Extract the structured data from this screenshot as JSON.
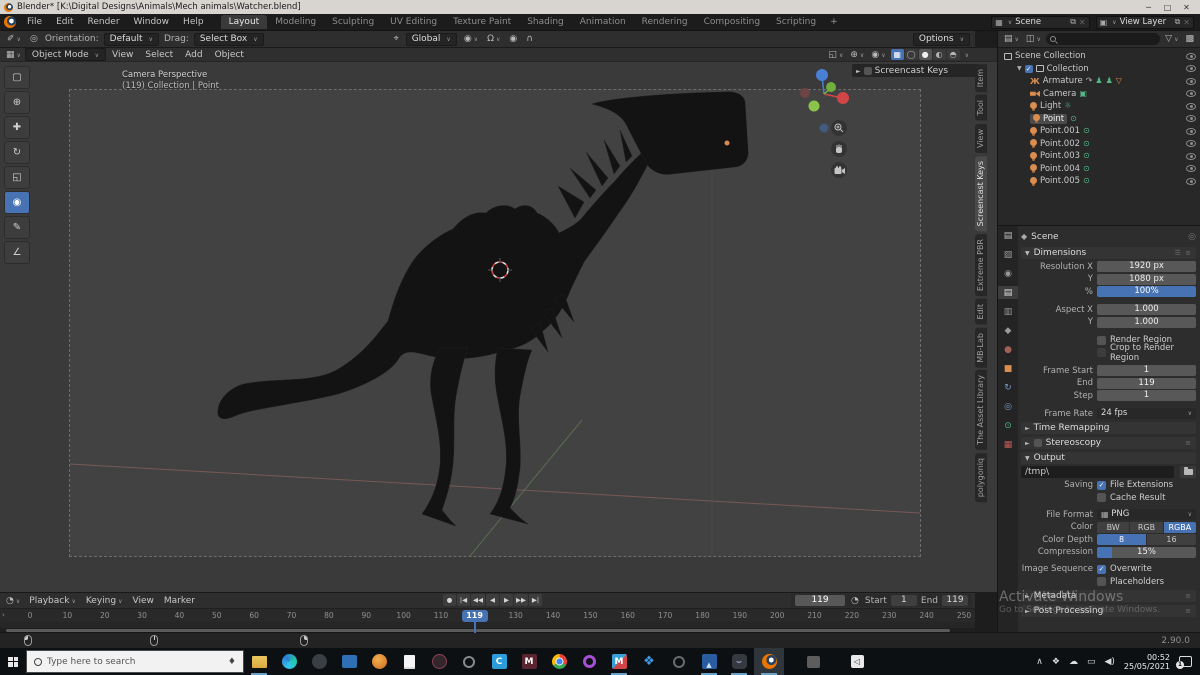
{
  "window": {
    "title": "Blender* [K:\\Digital Designs\\Animals\\Mech animals\\Watcher.blend]",
    "controls": [
      "─",
      "□",
      "✕"
    ],
    "version": "2.90.0"
  },
  "topbar": {
    "menus": [
      "File",
      "Edit",
      "Render",
      "Window",
      "Help"
    ],
    "workspaces": [
      "Layout",
      "Modeling",
      "Sculpting",
      "UV Editing",
      "Texture Paint",
      "Shading",
      "Animation",
      "Rendering",
      "Compositing",
      "Scripting"
    ],
    "active_workspace": "Layout",
    "new_workspace": "+",
    "scene": "Scene",
    "view_layer": "View Layer"
  },
  "tool_settings": {
    "orientation_label": "Orientation:",
    "orientation_value": "Default",
    "drag_label": "Drag:",
    "drag_value": "Select Box",
    "transform_orientation": "Global",
    "options_label": "Options"
  },
  "viewport": {
    "header_menus": [
      "Object Mode",
      "View",
      "Select",
      "Add",
      "Object"
    ],
    "overlay_line1": "Camera Perspective",
    "overlay_line2": "(119) Collection | Point",
    "screencast_title": "Screencast Keys",
    "sidebar_tabs": [
      "Item",
      "Tool",
      "View",
      "Screencast Keys",
      "Extreme PBR",
      "Edit",
      "MB-Lab",
      "The Asset Library",
      "polygoniq"
    ],
    "active_sidebar_tab": "Screencast Keys",
    "tools": [
      {
        "name": "select-box-tool",
        "glyph": "▢"
      },
      {
        "name": "cursor-tool",
        "glyph": "⊕"
      },
      {
        "name": "move-tool",
        "glyph": "✚"
      },
      {
        "name": "rotate-tool",
        "glyph": "↻"
      },
      {
        "name": "scale-tool",
        "glyph": "◱"
      },
      {
        "name": "transform-tool",
        "glyph": "◉"
      },
      {
        "name": "annotate-tool",
        "glyph": "✎"
      },
      {
        "name": "measure-tool",
        "glyph": "∠"
      }
    ],
    "active_tool": "transform-tool",
    "shading_modes": [
      {
        "name": "toggle-xray",
        "glyph": "▦",
        "state": "xray"
      },
      {
        "name": "wireframe-shading",
        "glyph": "◯",
        "state": ""
      },
      {
        "name": "solid-shading",
        "glyph": "●",
        "state": "on"
      },
      {
        "name": "material-shading",
        "glyph": "◐",
        "state": ""
      },
      {
        "name": "rendered-shading",
        "glyph": "◓",
        "state": ""
      }
    ]
  },
  "outliner": {
    "rows": [
      {
        "label": "Scene Collection",
        "level": 0,
        "icon": "box",
        "disclosure": false,
        "checkbox": false,
        "selected": false,
        "badges": []
      },
      {
        "label": "Collection",
        "level": 1,
        "icon": "box",
        "disclosure": true,
        "checkbox": true,
        "selected": false,
        "badges": []
      },
      {
        "label": "Armature",
        "level": 2,
        "icon": "armature",
        "disclosure": false,
        "checkbox": false,
        "selected": false,
        "badges": [
          "pose",
          "figure",
          "figure",
          "triangle"
        ]
      },
      {
        "label": "Camera",
        "level": 2,
        "icon": "camera",
        "disclosure": false,
        "checkbox": false,
        "selected": false,
        "badges": [
          "camera-data"
        ]
      },
      {
        "label": "Light",
        "level": 2,
        "icon": "bulb",
        "disclosure": false,
        "checkbox": false,
        "selected": false,
        "badges": [
          "sun-data"
        ]
      },
      {
        "label": "Point",
        "level": 2,
        "icon": "bulb",
        "disclosure": false,
        "checkbox": false,
        "selected": true,
        "badges": [
          "light-data"
        ]
      },
      {
        "label": "Point.001",
        "level": 2,
        "icon": "bulb",
        "disclosure": false,
        "checkbox": false,
        "selected": false,
        "badges": [
          "light-data"
        ]
      },
      {
        "label": "Point.002",
        "level": 2,
        "icon": "bulb",
        "disclosure": false,
        "checkbox": false,
        "selected": false,
        "badges": [
          "light-data"
        ]
      },
      {
        "label": "Point.003",
        "level": 2,
        "icon": "bulb",
        "disclosure": false,
        "checkbox": false,
        "selected": false,
        "badges": [
          "light-data"
        ]
      },
      {
        "label": "Point.004",
        "level": 2,
        "icon": "bulb",
        "disclosure": false,
        "checkbox": false,
        "selected": false,
        "badges": [
          "light-data"
        ]
      },
      {
        "label": "Point.005",
        "level": 2,
        "icon": "bulb",
        "disclosure": false,
        "checkbox": false,
        "selected": false,
        "badges": [
          "light-data"
        ]
      }
    ]
  },
  "properties": {
    "breadcrumb": "Scene",
    "tabs": [
      {
        "name": "properties-editor-type",
        "glyph": "▤",
        "color": "#c0c0c0",
        "active": false
      },
      {
        "name": "properties-tab-tool",
        "glyph": "▨",
        "color": "#9a9a9a",
        "active": false
      },
      {
        "name": "properties-tab-render",
        "glyph": "◉",
        "color": "#9a9a9a",
        "active": false
      },
      {
        "name": "properties-tab-output",
        "glyph": "▤",
        "color": "#e0e0e0",
        "active": true
      },
      {
        "name": "properties-tab-view-layer",
        "glyph": "▥",
        "color": "#9a9a9a",
        "active": false
      },
      {
        "name": "properties-tab-scene",
        "glyph": "◆",
        "color": "#9a9a9a",
        "active": false
      },
      {
        "name": "properties-tab-world",
        "glyph": "●",
        "color": "#a06058",
        "active": false
      },
      {
        "name": "properties-tab-object",
        "glyph": "■",
        "color": "#d98d4e",
        "active": false
      },
      {
        "name": "properties-tab-physics",
        "glyph": "↻",
        "color": "#7a9cc9",
        "active": false
      },
      {
        "name": "properties-tab-constraints",
        "glyph": "◎",
        "color": "#7a9cc9",
        "active": false
      },
      {
        "name": "properties-tab-data",
        "glyph": "⊙",
        "color": "#55b685",
        "active": false
      },
      {
        "name": "properties-tab-texture",
        "glyph": "▦",
        "color": "#c25b5b",
        "active": false
      }
    ],
    "dimensions": {
      "title": "Dimensions",
      "resolution_x_label": "Resolution X",
      "resolution_x": "1920 px",
      "resolution_y_label": "Y",
      "resolution_y": "1080 px",
      "percent_label": "%",
      "percent": "100%",
      "aspect_x_label": "Aspect X",
      "aspect_x": "1.000",
      "aspect_y_label": "Y",
      "aspect_y": "1.000",
      "render_region_label": "Render Region",
      "crop_label": "Crop to Render Region",
      "frame_start_label": "Frame Start",
      "frame_start": "1",
      "end_label": "End",
      "end": "119",
      "step_label": "Step",
      "step": "1",
      "frame_rate_label": "Frame Rate",
      "frame_rate": "24 fps"
    },
    "sections": {
      "time_remapping": "Time Remapping",
      "stereoscopy": "Stereoscopy",
      "output": "Output",
      "metadata": "Metadata",
      "post_processing": "Post Processing"
    },
    "output": {
      "path": "/tmp\\",
      "saving_label": "Saving",
      "file_extensions_label": "File Extensions",
      "cache_result_label": "Cache Result",
      "file_format_label": "File Format",
      "file_format": "PNG",
      "color_label": "Color",
      "color_options": [
        "BW",
        "RGB",
        "RGBA"
      ],
      "color_active": "RGBA",
      "color_depth_label": "Color Depth",
      "depth_options": [
        "8",
        "16"
      ],
      "depth_active": "8",
      "compression_label": "Compression",
      "compression": "15%",
      "image_sequence_label": "Image Sequence",
      "overwrite_label": "Overwrite",
      "placeholders_label": "Placeholders"
    }
  },
  "timeline": {
    "menus": [
      "Playback",
      "Keying",
      "View",
      "Marker"
    ],
    "transport": [
      {
        "name": "record-button",
        "glyph": "●"
      },
      {
        "name": "jump-to-start-button",
        "glyph": "|◀"
      },
      {
        "name": "previous-keyframe-button",
        "glyph": "◀◀"
      },
      {
        "name": "play-reverse-button",
        "glyph": "◀"
      },
      {
        "name": "play-button",
        "glyph": "▶"
      },
      {
        "name": "next-keyframe-button",
        "glyph": "▶▶"
      },
      {
        "name": "jump-to-end-button",
        "glyph": "▶|"
      }
    ],
    "current_frame": "119",
    "start_label": "Start",
    "start": "1",
    "end_label": "End",
    "end": "119",
    "ruler": [
      0,
      10,
      20,
      30,
      40,
      50,
      60,
      70,
      80,
      90,
      100,
      110,
      130,
      140,
      150,
      160,
      170,
      180,
      190,
      200,
      210,
      220,
      230,
      240,
      250
    ],
    "playhead_frame": 119
  },
  "statusbar": {
    "version": "2.90.0"
  },
  "taskbar": {
    "search_placeholder": "Type here to search",
    "icons": [
      {
        "name": "file-explorer-icon",
        "cls": "tb-folder",
        "glyph": "",
        "running": true,
        "active": false
      },
      {
        "name": "edge-icon",
        "cls": "tb-edge",
        "glyph": "",
        "running": false,
        "active": false
      },
      {
        "name": "app-dark-icon",
        "cls": "tb-dark",
        "glyph": "",
        "running": false,
        "active": false
      },
      {
        "name": "app-blue-window-icon",
        "cls": "tb-bluewin",
        "glyph": "",
        "running": false,
        "active": false
      },
      {
        "name": "app-orange-icon",
        "cls": "tb-orange",
        "glyph": "",
        "running": false,
        "active": false
      },
      {
        "name": "notepad-icon",
        "cls": "tb-doc",
        "glyph": "",
        "running": false,
        "active": false
      },
      {
        "name": "app-dark-red-icon",
        "cls": "tb-darkred",
        "glyph": "",
        "running": false,
        "active": false
      },
      {
        "name": "app-grey-circle-icon",
        "cls": "tb-greycircle",
        "glyph": "",
        "running": false,
        "active": false
      },
      {
        "name": "app-blue-c-icon",
        "cls": "tb-bluec",
        "glyph": "C",
        "running": false,
        "active": false
      },
      {
        "name": "app-maroon-m-icon",
        "cls": "tb-maroonm",
        "glyph": "M",
        "running": false,
        "active": false
      },
      {
        "name": "chrome-icon",
        "cls": "tb-chrome",
        "glyph": "",
        "running": false,
        "active": false
      },
      {
        "name": "opera-icon",
        "cls": "tb-opera",
        "glyph": "",
        "running": false,
        "active": false
      },
      {
        "name": "app-m-color-icon",
        "cls": "tb-mcolor",
        "glyph": "M",
        "running": true,
        "active": false
      },
      {
        "name": "dropbox-icon",
        "cls": "tb-dropbox",
        "glyph": "❖",
        "running": false,
        "active": false
      },
      {
        "name": "app-ring-icon",
        "cls": "tb-ring",
        "glyph": "",
        "running": false,
        "active": false
      },
      {
        "name": "photos-icon",
        "cls": "tb-photos",
        "glyph": "▲",
        "running": true,
        "active": false
      },
      {
        "name": "discord-icon",
        "cls": "tb-discord",
        "glyph": "⌣",
        "running": true,
        "active": false
      },
      {
        "name": "blender-icon",
        "cls": "tb-blender",
        "glyph": "",
        "running": true,
        "active": true
      },
      {
        "name": "app-grey-2-icon",
        "cls": "tb-grey2",
        "glyph": "",
        "running": false,
        "active": false,
        "gap": true
      },
      {
        "name": "app-white-square-icon",
        "cls": "tb-whitesq",
        "glyph": "◁",
        "running": false,
        "active": false,
        "gap": true
      }
    ],
    "tray": [
      {
        "name": "tray-expand-icon",
        "glyph": "∧"
      },
      {
        "name": "tray-dropbox-icon",
        "glyph": "❖"
      },
      {
        "name": "tray-onedrive-icon",
        "glyph": "☁"
      },
      {
        "name": "tray-network-icon",
        "glyph": "▭"
      },
      {
        "name": "tray-volume-icon",
        "glyph": "◀)"
      }
    ],
    "clock_time": "00:52",
    "clock_date": "25/05/2021"
  },
  "watermark": {
    "line1": "Activate Windows",
    "line2": "Go to Settings to activate Windows."
  },
  "colors": {
    "accent_blue": "#4772b3",
    "blender_orange": "#ea7600",
    "data_green": "#55b685",
    "object_orange": "#d98d4e"
  }
}
